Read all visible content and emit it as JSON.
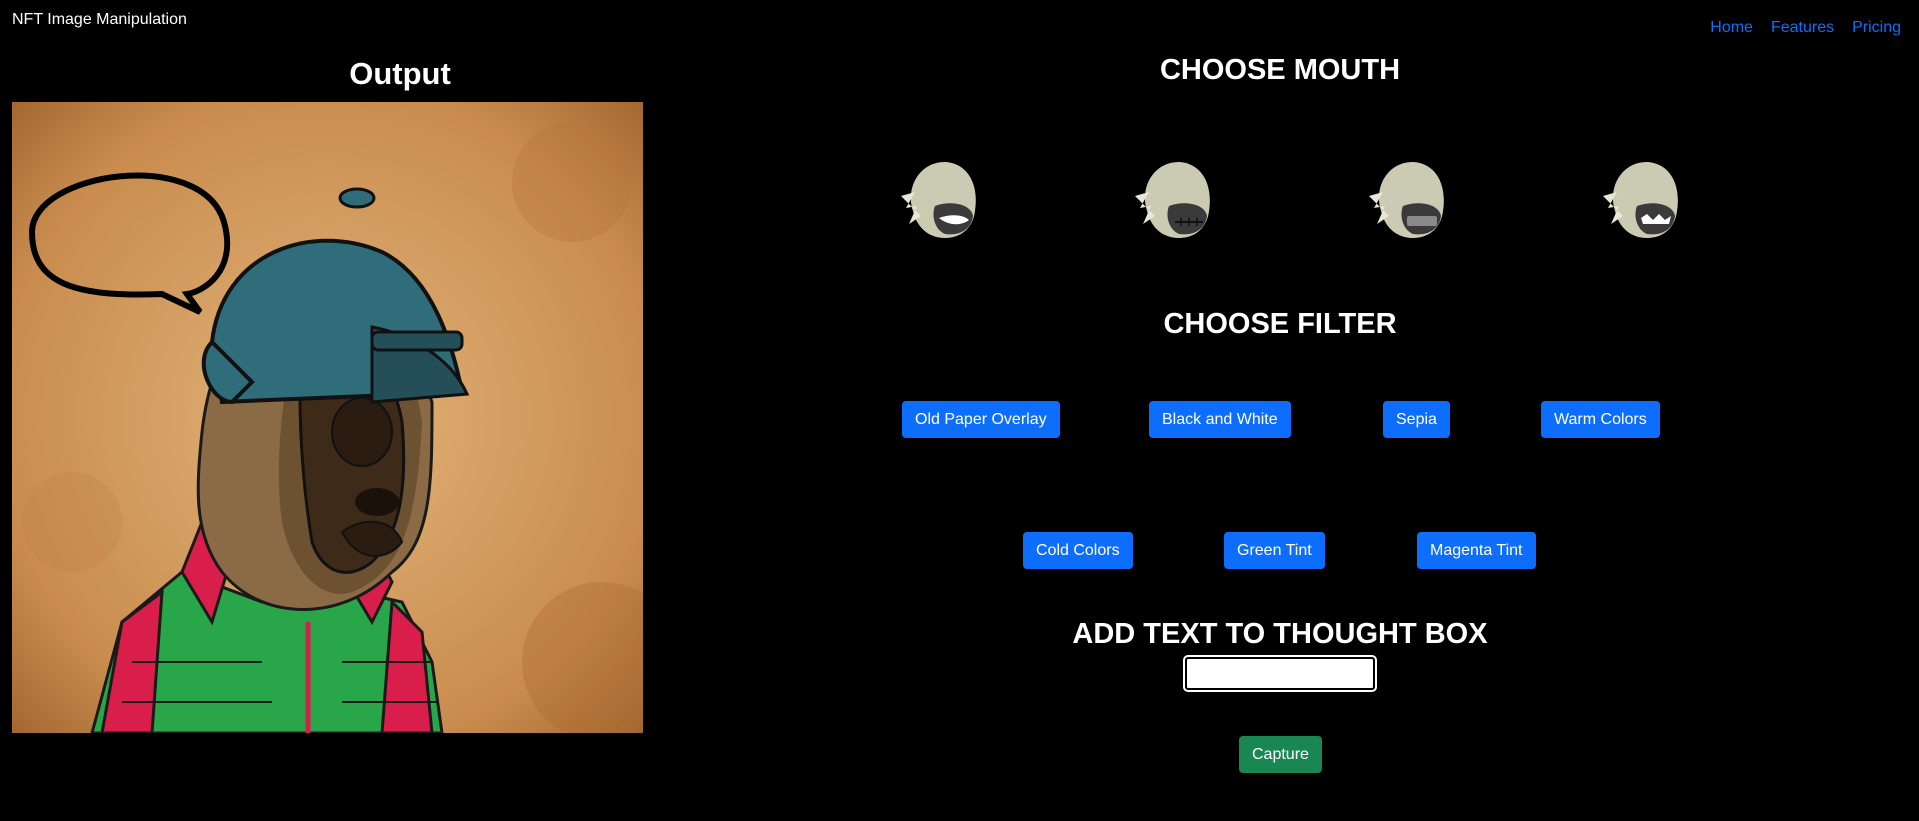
{
  "header": {
    "brand": "NFT Image Manipulation",
    "nav": [
      "Home",
      "Features",
      "Pricing"
    ],
    "link_color": "#0d6efd"
  },
  "output": {
    "title": "Output"
  },
  "mouth": {
    "title": "CHOOSE MOUTH",
    "options": [
      {
        "icon": "mouth-option-1"
      },
      {
        "icon": "mouth-option-2"
      },
      {
        "icon": "mouth-option-3"
      },
      {
        "icon": "mouth-option-4"
      }
    ]
  },
  "filter": {
    "title": "CHOOSE FILTER",
    "buttons": [
      "Old Paper Overlay",
      "Black and White",
      "Sepia",
      "Warm Colors",
      "Cold Colors",
      "Green Tint",
      "Magenta Tint"
    ],
    "button_color": "#0d6efd"
  },
  "thought": {
    "title": "ADD TEXT TO THOUGHT BOX",
    "value": "",
    "placeholder": ""
  },
  "capture": {
    "label": "Capture",
    "color": "#198754"
  }
}
